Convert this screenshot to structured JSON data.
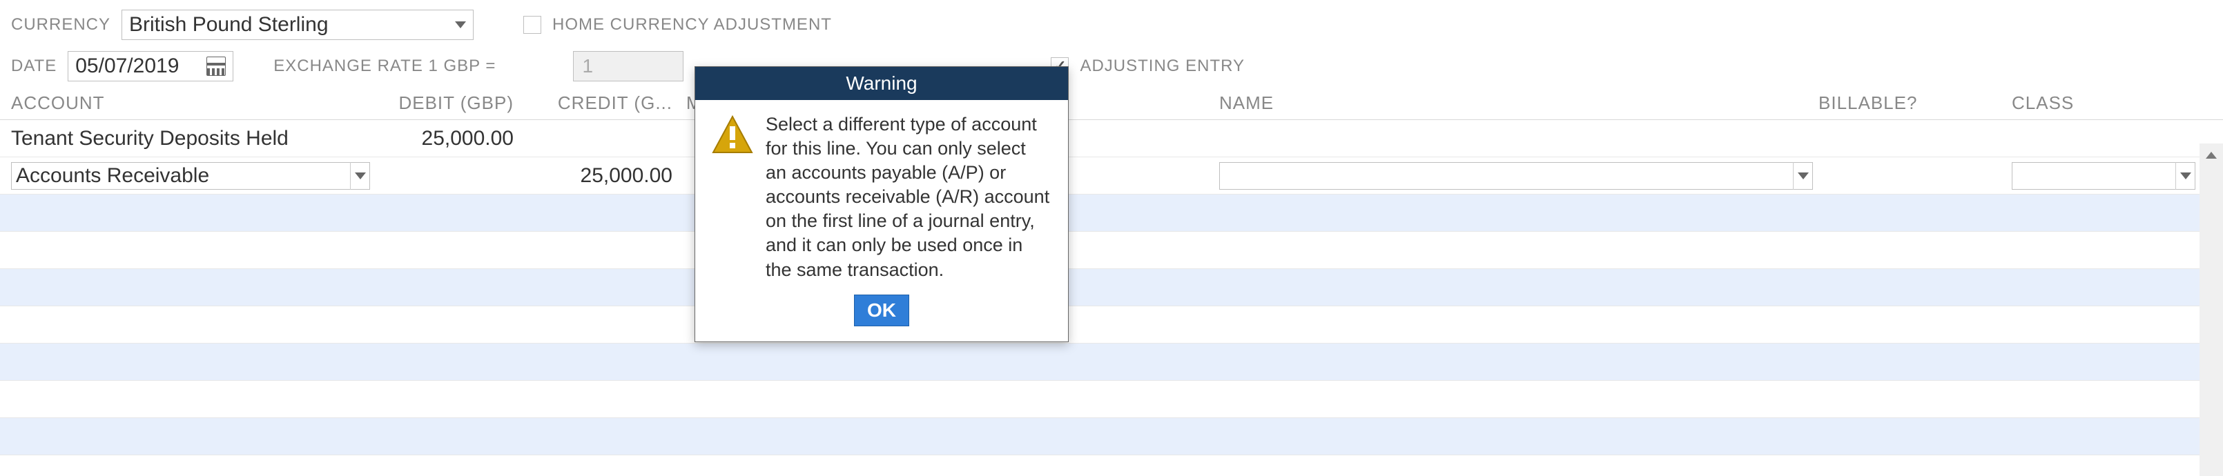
{
  "labels": {
    "currency": "CURRENCY",
    "home_currency_adj": "HOME CURRENCY ADJUSTMENT",
    "date": "DATE",
    "exchange_rate_prefix": "EXCHANGE RATE 1 GBP =",
    "adjusting_entry": "ADJUSTING ENTRY"
  },
  "fields": {
    "currency_value": "British Pound Sterling",
    "date_value": "05/07/2019",
    "exchange_rate_value": "1",
    "home_currency_checked": false,
    "adjusting_entry_checked": true
  },
  "columns": {
    "account": "ACCOUNT",
    "debit": "DEBIT (GBP)",
    "credit": "CREDIT (G...",
    "memo": "ME",
    "name": "NAME",
    "billable": "BILLABLE?",
    "class": "CLASS"
  },
  "rows": [
    {
      "account": "Tenant Security Deposits Held",
      "debit": "25,000.00",
      "credit": "",
      "memo": "",
      "name": "",
      "billable": "",
      "class": ""
    },
    {
      "account": "Accounts Receivable",
      "debit": "",
      "credit": "25,000.00",
      "memo": "",
      "name": "",
      "billable": "",
      "class": ""
    }
  ],
  "dialog": {
    "title": "Warning",
    "message": "Select a different type of account for this line. You can only select an accounts payable (A/P) or accounts receivable (A/R) account on the first line of a journal entry, and it can only be used once in the same transaction.",
    "ok": "OK"
  }
}
